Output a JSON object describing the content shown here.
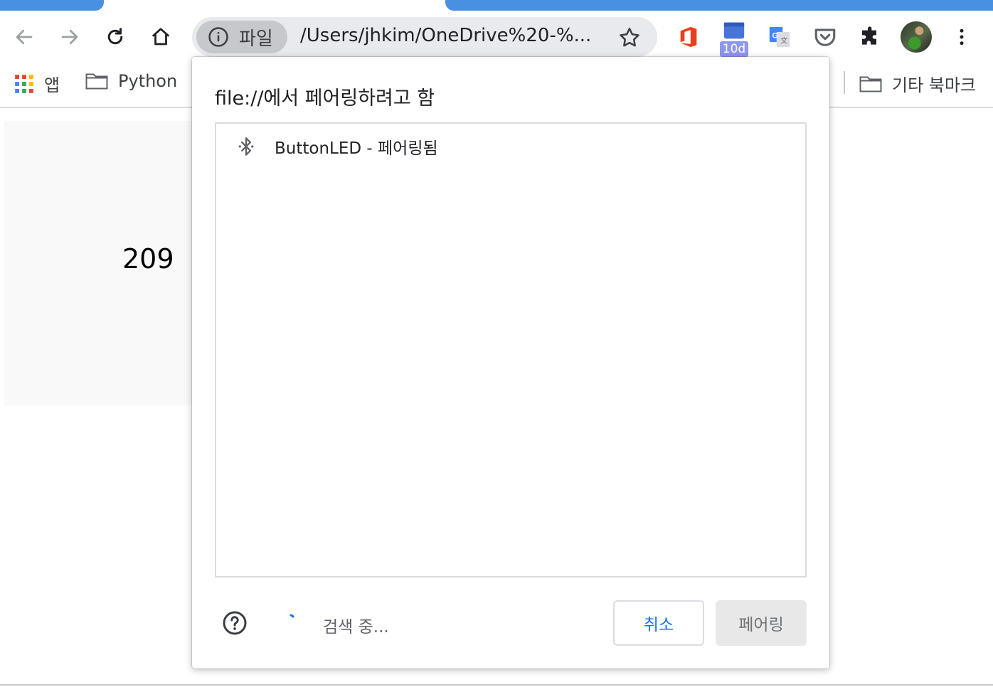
{
  "browser": {
    "omnibox": {
      "chip_label": "파일",
      "url": "/Users/jhkim/OneDrive%20-%..."
    },
    "extensions": [
      {
        "icon": "office-icon",
        "badge": ""
      },
      {
        "icon": "calendar-icon",
        "badge": "10d"
      },
      {
        "icon": "google-translate-icon",
        "badge": ""
      },
      {
        "icon": "pocket-icon",
        "badge": ""
      },
      {
        "icon": "puzzle-icon",
        "badge": ""
      },
      {
        "icon": "profile-avatar",
        "badge": ""
      }
    ],
    "bookmarks": {
      "apps_label": "앱",
      "folder_python": "Python",
      "other_bookmarks": "기타 북마크"
    }
  },
  "page": {
    "counter_value": "209"
  },
  "dialog": {
    "title": "file://에서 페어링하려고 함",
    "devices": [
      {
        "icon": "bluetooth-icon",
        "label": "ButtonLED - 페어링됨"
      }
    ],
    "status_text": "검색 중...",
    "cancel_label": "취소",
    "pair_label": "페어링"
  },
  "colors": {
    "accent_blue": "#4a90e2",
    "link_blue": "#1a73e8",
    "badge_purple": "#8f96f0"
  }
}
